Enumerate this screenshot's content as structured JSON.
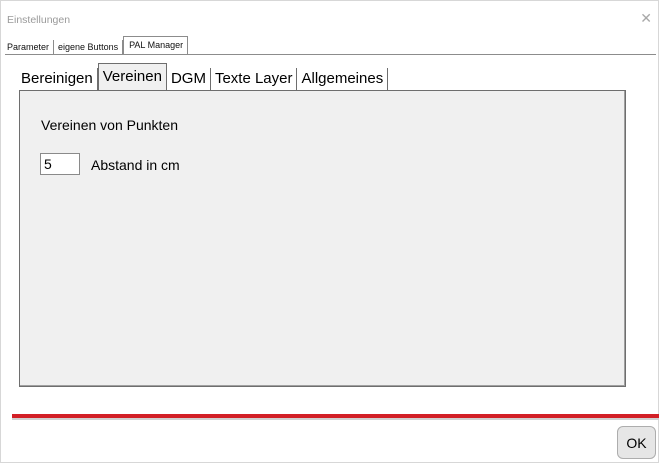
{
  "window": {
    "title": "Einstellungen",
    "close_glyph": "✕"
  },
  "outer_tabs": [
    {
      "label": "Parameter",
      "active": false
    },
    {
      "label": "eigene Buttons",
      "active": false
    },
    {
      "label": "PAL Manager",
      "active": true
    }
  ],
  "inner_tabs": [
    {
      "label": "Bereinigen",
      "active": false
    },
    {
      "label": "Vereinen",
      "active": true
    },
    {
      "label": "DGM",
      "active": false
    },
    {
      "label": "Texte Layer",
      "active": false
    },
    {
      "label": "Allgemeines",
      "active": false
    }
  ],
  "panel": {
    "section_title": "Vereinen von Punkten",
    "distance_value": "5",
    "distance_label": "Abstand in cm"
  },
  "footer": {
    "ok_label": "OK"
  },
  "colors": {
    "accent_divider": "#d21f26",
    "panel_bg": "#f0f0f0"
  }
}
